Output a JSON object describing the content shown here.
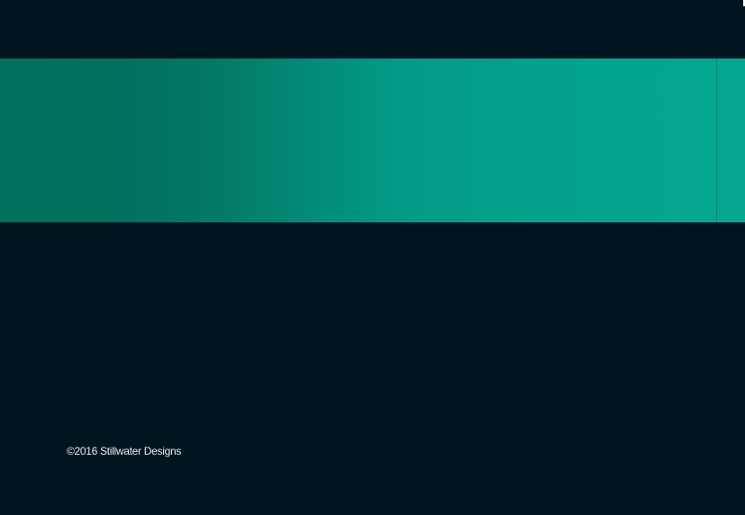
{
  "footer": {
    "copyright": "©2016 Stillwater Designs"
  },
  "colors": {
    "background": "#011520",
    "banner_start": "#03705f",
    "banner_end": "#05a690",
    "text": "#e8eef0"
  }
}
